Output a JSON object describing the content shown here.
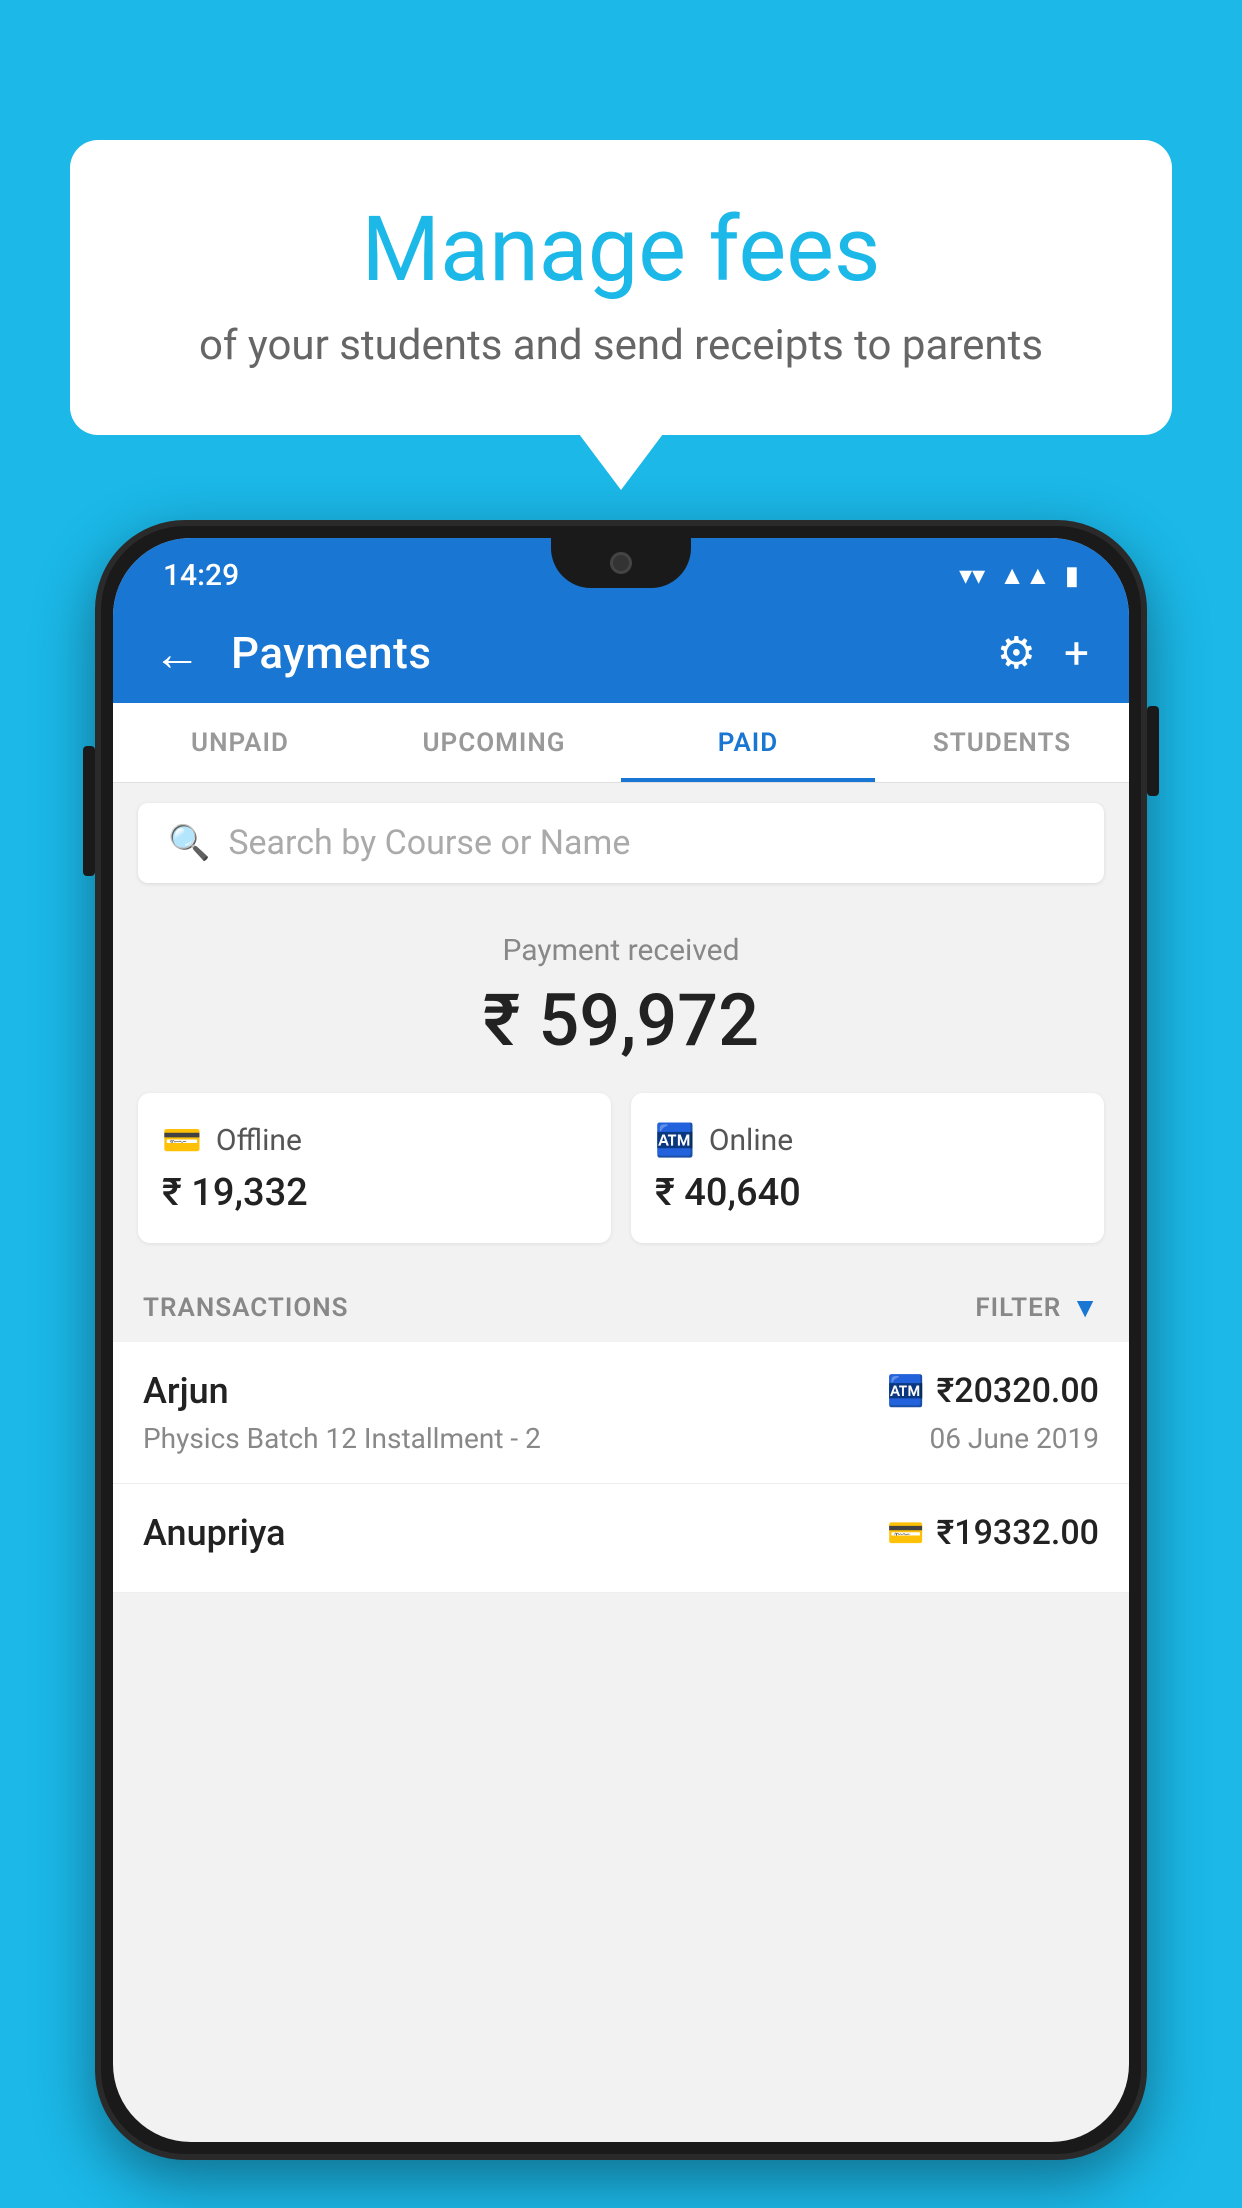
{
  "background_color": "#1BB8E8",
  "speech_bubble": {
    "title": "Manage fees",
    "subtitle": "of your students and send receipts to parents"
  },
  "phone": {
    "status_bar": {
      "time": "14:29",
      "icons": [
        "wifi",
        "signal",
        "battery"
      ]
    },
    "top_bar": {
      "back_label": "←",
      "title": "Payments",
      "gear_icon": "⚙",
      "plus_icon": "+"
    },
    "tabs": [
      {
        "label": "UNPAID",
        "active": false
      },
      {
        "label": "UPCOMING",
        "active": false
      },
      {
        "label": "PAID",
        "active": true
      },
      {
        "label": "STUDENTS",
        "active": false
      }
    ],
    "search": {
      "placeholder": "Search by Course or Name"
    },
    "payment_summary": {
      "label": "Payment received",
      "amount": "₹ 59,972",
      "offline": {
        "type": "Offline",
        "amount": "₹ 19,332"
      },
      "online": {
        "type": "Online",
        "amount": "₹ 40,640"
      }
    },
    "transactions": {
      "section_label": "TRANSACTIONS",
      "filter_label": "FILTER",
      "items": [
        {
          "name": "Arjun",
          "amount": "₹20320.00",
          "course": "Physics Batch 12 Installment - 2",
          "date": "06 June 2019",
          "payment_type": "online"
        },
        {
          "name": "Anupriya",
          "amount": "₹19332.00",
          "course": "",
          "date": "",
          "payment_type": "offline"
        }
      ]
    }
  }
}
